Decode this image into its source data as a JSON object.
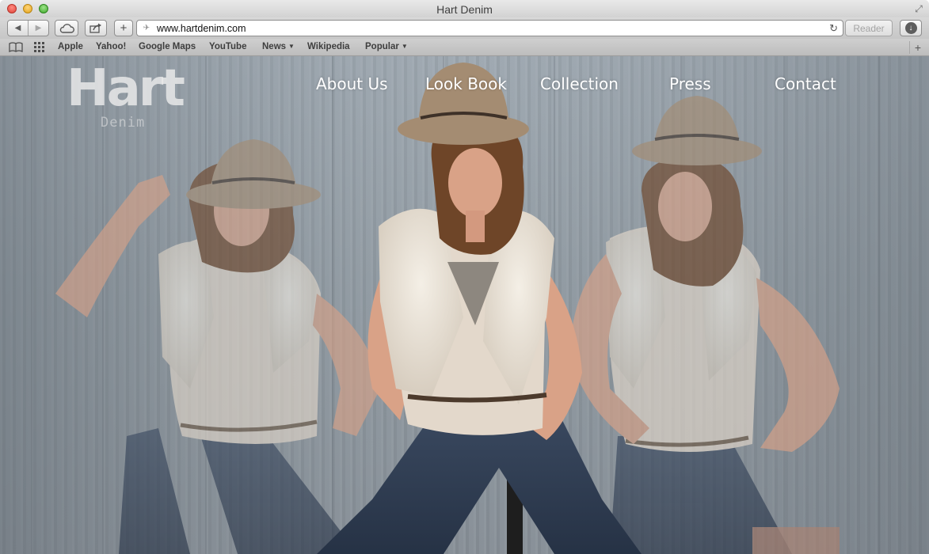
{
  "window": {
    "title": "Hart Denim"
  },
  "toolbar": {
    "url": "www.hartdenim.com",
    "reader_label": "Reader",
    "add_tab_label": "+"
  },
  "bookmarks": {
    "items": [
      {
        "label": "Apple",
        "dropdown": false
      },
      {
        "label": "Yahoo!",
        "dropdown": false
      },
      {
        "label": "Google Maps",
        "dropdown": false
      },
      {
        "label": "YouTube",
        "dropdown": false
      },
      {
        "label": "News",
        "dropdown": true
      },
      {
        "label": "Wikipedia",
        "dropdown": false
      },
      {
        "label": "Popular",
        "dropdown": true
      }
    ]
  },
  "site": {
    "logo_main": "Hart",
    "logo_sub": "Denim",
    "nav": [
      {
        "label": "About Us"
      },
      {
        "label": "Look Book"
      },
      {
        "label": "Collection"
      },
      {
        "label": "Press"
      },
      {
        "label": "Contact"
      }
    ]
  },
  "colors": {
    "background_wall": "#8a949c",
    "vest": "#e3d8cb",
    "hat": "#a48c72",
    "denim": "#2f3d52",
    "skin": "#d9a287",
    "hair": "#6e4528"
  },
  "icons": {
    "back": "back-arrow-icon",
    "forward": "forward-arrow-icon",
    "icloud": "cloud-icon",
    "share": "share-icon",
    "reload": "reload-icon",
    "download": "download-icon",
    "bookmarks": "open-book-icon",
    "top_sites": "grid-icon"
  }
}
